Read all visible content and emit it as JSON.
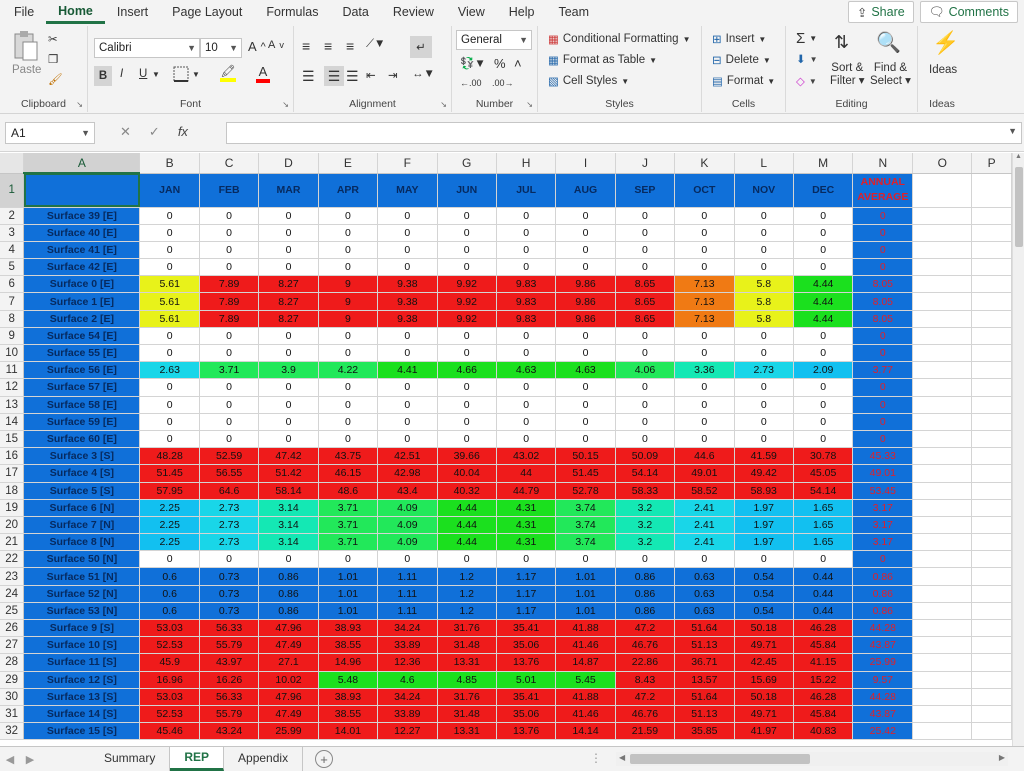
{
  "menu": {
    "items": [
      "File",
      "Home",
      "Insert",
      "Page Layout",
      "Formulas",
      "Data",
      "Review",
      "View",
      "Help",
      "Team"
    ],
    "active": "Home",
    "share_label": "Share",
    "comments_label": "Comments"
  },
  "ribbon": {
    "clipboard": {
      "name": "Clipboard",
      "paste_label": "Paste"
    },
    "font": {
      "name": "Font",
      "font_name": "Calibri",
      "font_size": "10",
      "bold": "B",
      "italic": "I",
      "underline": "U"
    },
    "alignment": {
      "name": "Alignment"
    },
    "number": {
      "name": "Number",
      "format": "General"
    },
    "styles": {
      "name": "Styles",
      "conditional": "Conditional Formatting",
      "format_table": "Format as Table",
      "cell_styles": "Cell Styles"
    },
    "cells": {
      "name": "Cells",
      "insert": "Insert",
      "delete": "Delete",
      "format": "Format"
    },
    "editing": {
      "name": "Editing",
      "sort": "Sort &",
      "sort2": "Filter",
      "find": "Find &",
      "find2": "Select"
    },
    "ideas": {
      "name": "Ideas",
      "label": "Ideas"
    }
  },
  "formula_bar": {
    "cell_ref": "A1",
    "fx": "fx",
    "value": ""
  },
  "sheet": {
    "columns": [
      "A",
      "B",
      "C",
      "D",
      "E",
      "F",
      "G",
      "H",
      "I",
      "J",
      "K",
      "L",
      "M",
      "N",
      "O",
      "P"
    ],
    "header_row": [
      "",
      "JAN",
      "FEB",
      "MAR",
      "APR",
      "MAY",
      "JUN",
      "JUL",
      "AUG",
      "SEP",
      "OCT",
      "NOV",
      "DEC",
      "ANNUAL AVERAGE"
    ],
    "rows": [
      {
        "n": "2",
        "label": "Surface 39 [E]",
        "vals": [
          "0",
          "0",
          "0",
          "0",
          "0",
          "0",
          "0",
          "0",
          "0",
          "0",
          "0",
          "0"
        ],
        "avg": "0"
      },
      {
        "n": "3",
        "label": "Surface 40 [E]",
        "vals": [
          "0",
          "0",
          "0",
          "0",
          "0",
          "0",
          "0",
          "0",
          "0",
          "0",
          "0",
          "0"
        ],
        "avg": "0"
      },
      {
        "n": "4",
        "label": "Surface 41 [E]",
        "vals": [
          "0",
          "0",
          "0",
          "0",
          "0",
          "0",
          "0",
          "0",
          "0",
          "0",
          "0",
          "0"
        ],
        "avg": "0"
      },
      {
        "n": "5",
        "label": "Surface 42 [E]",
        "vals": [
          "0",
          "0",
          "0",
          "0",
          "0",
          "0",
          "0",
          "0",
          "0",
          "0",
          "0",
          "0"
        ],
        "avg": "0"
      },
      {
        "n": "6",
        "label": "Surface 0 [E]",
        "vals": [
          "5.61",
          "7.89",
          "8.27",
          "9",
          "9.38",
          "9.92",
          "9.83",
          "9.86",
          "8.65",
          "7.13",
          "5.8",
          "4.44"
        ],
        "avg": "8.05"
      },
      {
        "n": "7",
        "label": "Surface 1 [E]",
        "vals": [
          "5.61",
          "7.89",
          "8.27",
          "9",
          "9.38",
          "9.92",
          "9.83",
          "9.86",
          "8.65",
          "7.13",
          "5.8",
          "4.44"
        ],
        "avg": "8.05"
      },
      {
        "n": "8",
        "label": "Surface 2 [E]",
        "vals": [
          "5.61",
          "7.89",
          "8.27",
          "9",
          "9.38",
          "9.92",
          "9.83",
          "9.86",
          "8.65",
          "7.13",
          "5.8",
          "4.44"
        ],
        "avg": "8.05"
      },
      {
        "n": "9",
        "label": "Surface 54 [E]",
        "vals": [
          "0",
          "0",
          "0",
          "0",
          "0",
          "0",
          "0",
          "0",
          "0",
          "0",
          "0",
          "0"
        ],
        "avg": "0"
      },
      {
        "n": "10",
        "label": "Surface 55 [E]",
        "vals": [
          "0",
          "0",
          "0",
          "0",
          "0",
          "0",
          "0",
          "0",
          "0",
          "0",
          "0",
          "0"
        ],
        "avg": "0"
      },
      {
        "n": "11",
        "label": "Surface 56 [E]",
        "vals": [
          "2.63",
          "3.71",
          "3.9",
          "4.22",
          "4.41",
          "4.66",
          "4.63",
          "4.63",
          "4.06",
          "3.36",
          "2.73",
          "2.09"
        ],
        "avg": "3.77"
      },
      {
        "n": "12",
        "label": "Surface 57 [E]",
        "vals": [
          "0",
          "0",
          "0",
          "0",
          "0",
          "0",
          "0",
          "0",
          "0",
          "0",
          "0",
          "0"
        ],
        "avg": "0"
      },
      {
        "n": "13",
        "label": "Surface 58 [E]",
        "vals": [
          "0",
          "0",
          "0",
          "0",
          "0",
          "0",
          "0",
          "0",
          "0",
          "0",
          "0",
          "0"
        ],
        "avg": "0"
      },
      {
        "n": "14",
        "label": "Surface 59 [E]",
        "vals": [
          "0",
          "0",
          "0",
          "0",
          "0",
          "0",
          "0",
          "0",
          "0",
          "0",
          "0",
          "0"
        ],
        "avg": "0"
      },
      {
        "n": "15",
        "label": "Surface 60 [E]",
        "vals": [
          "0",
          "0",
          "0",
          "0",
          "0",
          "0",
          "0",
          "0",
          "0",
          "0",
          "0",
          "0"
        ],
        "avg": "0"
      },
      {
        "n": "16",
        "label": "Surface 3 [S]",
        "vals": [
          "48.28",
          "52.59",
          "47.42",
          "43.75",
          "42.51",
          "39.66",
          "43.02",
          "50.15",
          "50.09",
          "44.6",
          "41.59",
          "30.78"
        ],
        "avg": "45.33"
      },
      {
        "n": "17",
        "label": "Surface 4 [S]",
        "vals": [
          "51.45",
          "56.55",
          "51.42",
          "46.15",
          "42.98",
          "40.04",
          "44",
          "51.45",
          "54.14",
          "49.01",
          "49.42",
          "45.05"
        ],
        "avg": "49.01"
      },
      {
        "n": "18",
        "label": "Surface 5 [S]",
        "vals": [
          "57.95",
          "64.6",
          "58.14",
          "48.6",
          "43.4",
          "40.32",
          "44.79",
          "52.78",
          "58.33",
          "58.52",
          "58.93",
          "54.14"
        ],
        "avg": "53.45"
      },
      {
        "n": "19",
        "label": "Surface 6 [N]",
        "vals": [
          "2.25",
          "2.73",
          "3.14",
          "3.71",
          "4.09",
          "4.44",
          "4.31",
          "3.74",
          "3.2",
          "2.41",
          "1.97",
          "1.65"
        ],
        "avg": "3.17"
      },
      {
        "n": "20",
        "label": "Surface 7 [N]",
        "vals": [
          "2.25",
          "2.73",
          "3.14",
          "3.71",
          "4.09",
          "4.44",
          "4.31",
          "3.74",
          "3.2",
          "2.41",
          "1.97",
          "1.65"
        ],
        "avg": "3.17"
      },
      {
        "n": "21",
        "label": "Surface 8 [N]",
        "vals": [
          "2.25",
          "2.73",
          "3.14",
          "3.71",
          "4.09",
          "4.44",
          "4.31",
          "3.74",
          "3.2",
          "2.41",
          "1.97",
          "1.65"
        ],
        "avg": "3.17"
      },
      {
        "n": "22",
        "label": "Surface 50 [N]",
        "vals": [
          "0",
          "0",
          "0",
          "0",
          "0",
          "0",
          "0",
          "0",
          "0",
          "0",
          "0",
          "0"
        ],
        "avg": "0"
      },
      {
        "n": "23",
        "label": "Surface 51 [N]",
        "vals": [
          "0.6",
          "0.73",
          "0.86",
          "1.01",
          "1.11",
          "1.2",
          "1.17",
          "1.01",
          "0.86",
          "0.63",
          "0.54",
          "0.44"
        ],
        "avg": "0.86"
      },
      {
        "n": "24",
        "label": "Surface 52 [N]",
        "vals": [
          "0.6",
          "0.73",
          "0.86",
          "1.01",
          "1.11",
          "1.2",
          "1.17",
          "1.01",
          "0.86",
          "0.63",
          "0.54",
          "0.44"
        ],
        "avg": "0.86"
      },
      {
        "n": "25",
        "label": "Surface 53 [N]",
        "vals": [
          "0.6",
          "0.73",
          "0.86",
          "1.01",
          "1.11",
          "1.2",
          "1.17",
          "1.01",
          "0.86",
          "0.63",
          "0.54",
          "0.44"
        ],
        "avg": "0.86"
      },
      {
        "n": "26",
        "label": "Surface 9 [S]",
        "vals": [
          "53.03",
          "56.33",
          "47.96",
          "38.93",
          "34.24",
          "31.76",
          "35.41",
          "41.88",
          "47.2",
          "51.64",
          "50.18",
          "46.28"
        ],
        "avg": "44.28"
      },
      {
        "n": "27",
        "label": "Surface 10 [S]",
        "vals": [
          "52.53",
          "55.79",
          "47.49",
          "38.55",
          "33.89",
          "31.48",
          "35.06",
          "41.46",
          "46.76",
          "51.13",
          "49.71",
          "45.84"
        ],
        "avg": "43.87"
      },
      {
        "n": "28",
        "label": "Surface 11 [S]",
        "vals": [
          "45.9",
          "43.97",
          "27.1",
          "14.96",
          "12.36",
          "13.31",
          "13.76",
          "14.87",
          "22.86",
          "36.71",
          "42.45",
          "41.15"
        ],
        "avg": "25.99"
      },
      {
        "n": "29",
        "label": "Surface 12 [S]",
        "vals": [
          "16.96",
          "16.26",
          "10.02",
          "5.48",
          "4.6",
          "4.85",
          "5.01",
          "5.45",
          "8.43",
          "13.57",
          "15.69",
          "15.22"
        ],
        "avg": "9.57"
      },
      {
        "n": "30",
        "label": "Surface 13 [S]",
        "vals": [
          "53.03",
          "56.33",
          "47.96",
          "38.93",
          "34.24",
          "31.76",
          "35.41",
          "41.88",
          "47.2",
          "51.64",
          "50.18",
          "46.28"
        ],
        "avg": "44.28"
      },
      {
        "n": "31",
        "label": "Surface 14 [S]",
        "vals": [
          "52.53",
          "55.79",
          "47.49",
          "38.55",
          "33.89",
          "31.48",
          "35.06",
          "41.46",
          "46.76",
          "51.13",
          "49.71",
          "45.84"
        ],
        "avg": "43.87"
      },
      {
        "n": "32",
        "label": "Surface 15 [S]",
        "vals": [
          "45.46",
          "43.24",
          "25.99",
          "14.01",
          "12.27",
          "13.31",
          "13.76",
          "14.14",
          "21.59",
          "35.85",
          "41.97",
          "40.83"
        ],
        "avg": "25.42"
      }
    ],
    "fills": {
      "yellow": "#e8f21a",
      "red": "#ef1b1b",
      "orange": "#f07a14",
      "green": "#1be01e",
      "green2": "#22e85a",
      "teal": "#14e8b4",
      "cyan": "#19d6e8",
      "cyan2": "#12c0f0",
      "blue": "#1070d9",
      "white": "#ffffff"
    }
  },
  "sheet_tabs": {
    "tabs": [
      "Summary",
      "REP",
      "Appendix"
    ],
    "active": "REP"
  }
}
